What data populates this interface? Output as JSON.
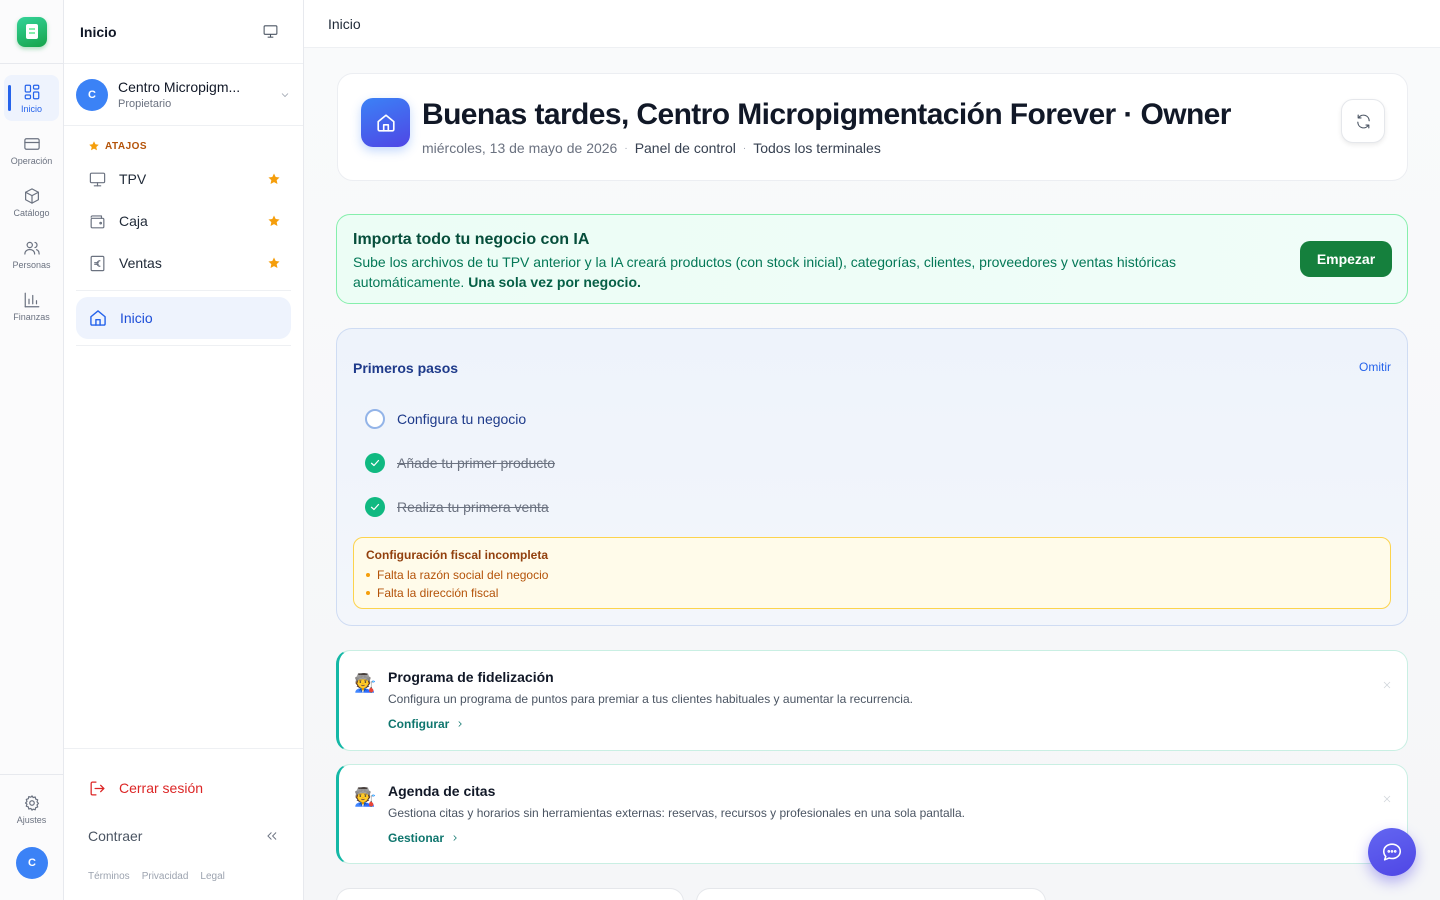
{
  "rail": {
    "items": [
      {
        "label": "Inicio"
      },
      {
        "label": "Operación"
      },
      {
        "label": "Catálogo"
      },
      {
        "label": "Personas"
      },
      {
        "label": "Finanzas"
      }
    ],
    "settings_label": "Ajustes",
    "avatar_initial": "C"
  },
  "sidebar": {
    "title": "Inicio",
    "org": {
      "initial": "C",
      "name": "Centro Micropigm...",
      "role": "Propietario"
    },
    "shortcuts_label": "ATAJOS",
    "shortcuts": [
      {
        "label": "TPV",
        "icon": "monitor-icon"
      },
      {
        "label": "Caja",
        "icon": "wallet-icon"
      },
      {
        "label": "Ventas",
        "icon": "euro-receipt-icon"
      }
    ],
    "active_item": "Inicio",
    "logout_label": "Cerrar sesión",
    "collapse_label": "Contraer",
    "legal_links": [
      "Términos",
      "Privacidad",
      "Legal"
    ]
  },
  "topbar": {
    "title": "Inicio"
  },
  "greeting": {
    "title": "Buenas tardes, Centro Micropigmentación Forever · Owner",
    "date": "miércoles, 13 de mayo de 2026",
    "panel": "Panel de control",
    "terminals": "Todos los terminales"
  },
  "ia_banner": {
    "title": "Importa todo tu negocio con IA",
    "text": "Sube los archivos de tu TPV anterior y la IA creará productos (con stock inicial), categorías, clientes, proveedores y ventas históricas automáticamente.",
    "text_bold": "Una sola vez por negocio.",
    "button": "Empezar"
  },
  "onboarding": {
    "title": "Primeros pasos",
    "skip": "Omitir",
    "steps": [
      {
        "label": "Configura tu negocio",
        "done": false
      },
      {
        "label": "Añade tu primer producto",
        "done": true
      },
      {
        "label": "Realiza tu primera venta",
        "done": true
      }
    ],
    "fiscal": {
      "title": "Configuración fiscal incompleta",
      "items": [
        "Falta la razón social del negocio",
        "Falta la dirección fiscal"
      ]
    }
  },
  "cards": [
    {
      "emoji": "🧑‍🏭",
      "title": "Programa de fidelización",
      "desc": "Configura un programa de puntos para premiar a tus clientes habituales y aumentar la recurrencia.",
      "link": "Configurar"
    },
    {
      "emoji": "🧑‍🏭",
      "title": "Agenda de citas",
      "desc": "Gestiona citas y horarios sin herramientas externas: reservas, recursos y profesionales en una sola pantalla.",
      "link": "Gestionar"
    }
  ],
  "colors": {
    "accent": "#2563eb",
    "success": "#15803d",
    "warning": "#f59e0b",
    "danger": "#dc2626"
  }
}
